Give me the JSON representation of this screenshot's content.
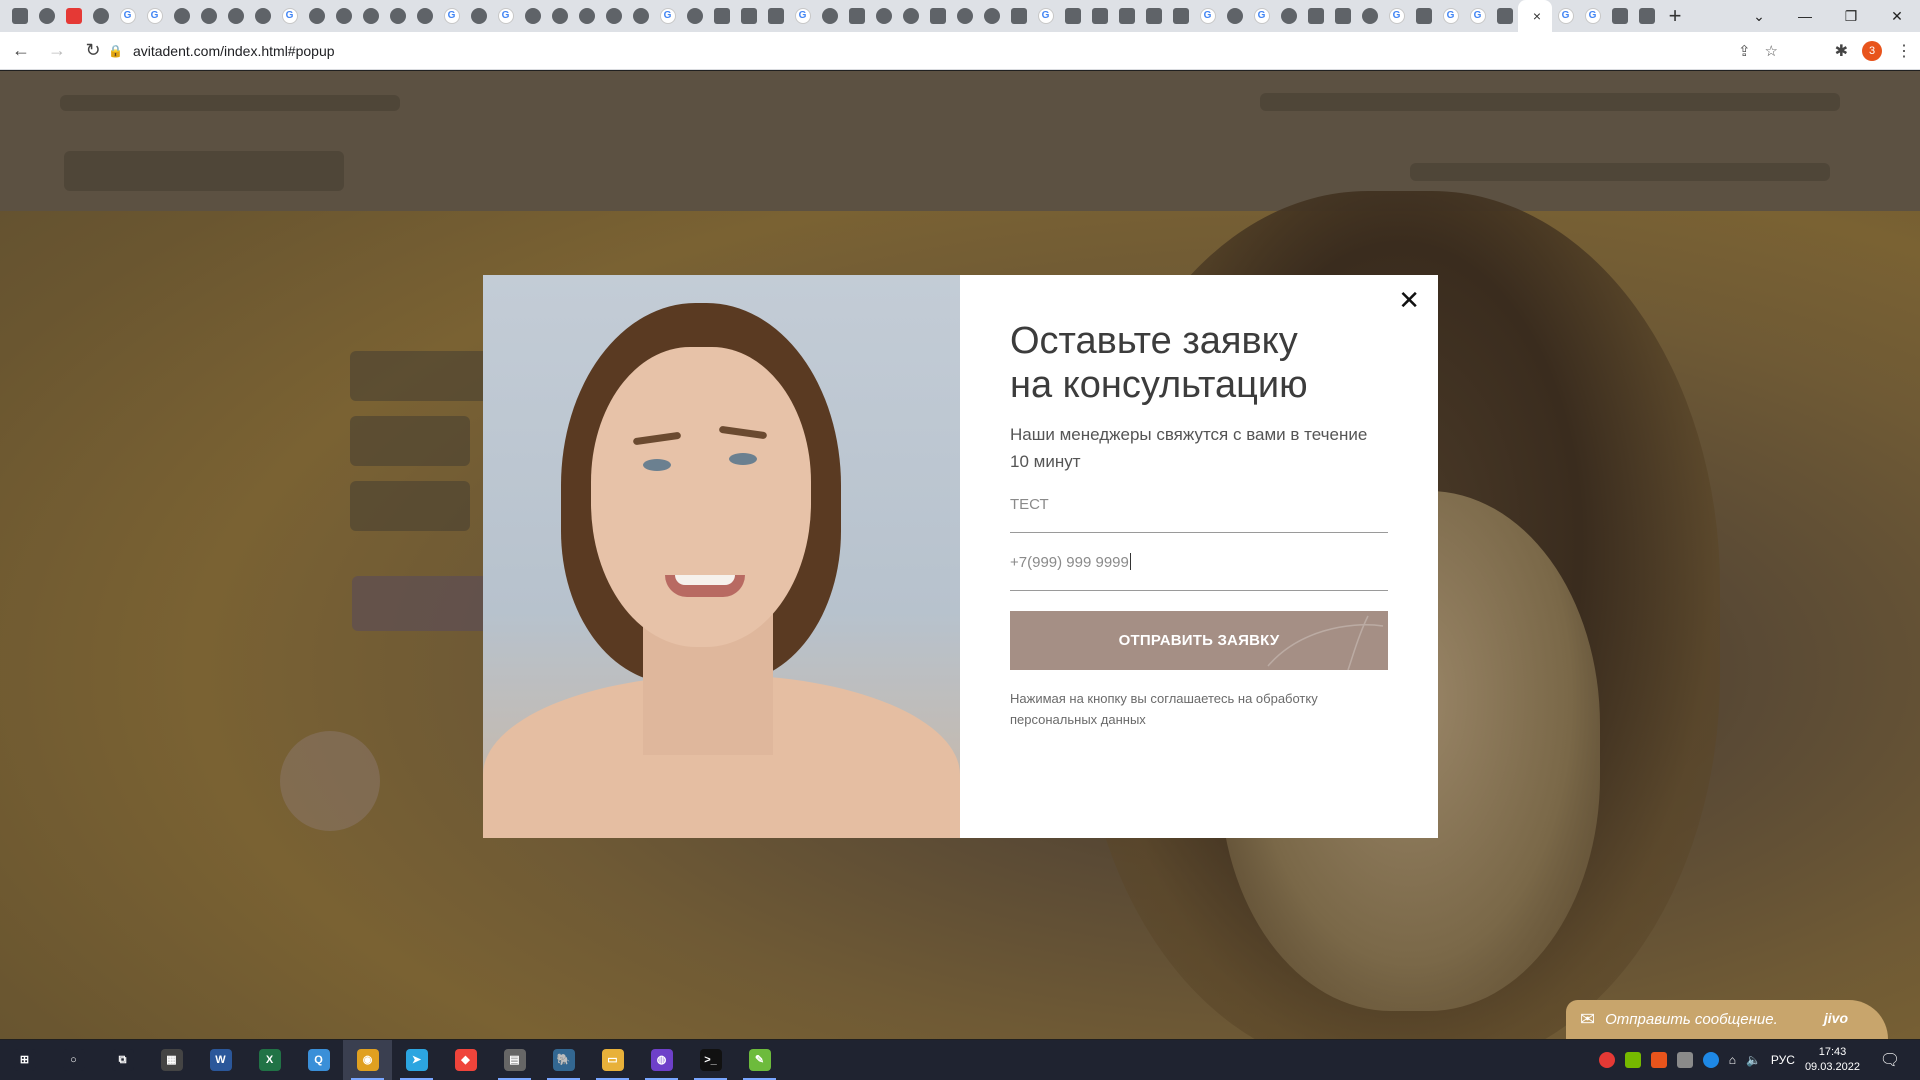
{
  "browser": {
    "tab_count_before_active": 56,
    "active_tab_close": "×",
    "new_tab": "+",
    "window_controls": {
      "dropdown": "⌄",
      "minimize": "—",
      "restore": "❐",
      "close": "✕"
    },
    "url": "avitadent.com/index.html#popup",
    "profile_badge": "3"
  },
  "modal": {
    "close_label": "✕",
    "title_line1": "Оставьте заявку",
    "title_line2": "на консультацию",
    "subtitle": "Наши менеджеры свяжутся с вами в течение 10 минут",
    "name_field_value": "ТЕСТ",
    "phone_field_value": "+7(999) 999 9999",
    "submit_label": "ОТПРАВИТЬ ЗАЯВКУ",
    "consent": "Нажимая на кнопку вы соглашаетесь на обработку персональных данных"
  },
  "jivo": {
    "text": "Отправить сообщение.",
    "logo": "jivo"
  },
  "taskbar": {
    "apps": [
      {
        "name": "start-icon",
        "glyph": "⊞",
        "color": "#1f2330"
      },
      {
        "name": "search-icon",
        "glyph": "○",
        "color": "#1f2330"
      },
      {
        "name": "task-view-icon",
        "glyph": "⧉",
        "color": "#1f2330"
      },
      {
        "name": "calculator-icon",
        "glyph": "▦",
        "color": "#444"
      },
      {
        "name": "word-icon",
        "glyph": "W",
        "color": "#2b579a"
      },
      {
        "name": "excel-icon",
        "glyph": "X",
        "color": "#217346"
      },
      {
        "name": "qbittorrent-icon",
        "glyph": "Q",
        "color": "#3a8fd8"
      },
      {
        "name": "chrome-icon",
        "glyph": "◉",
        "color": "#e0a020"
      },
      {
        "name": "telegram-icon",
        "glyph": "➤",
        "color": "#2ca5e0"
      },
      {
        "name": "anydesk-icon",
        "glyph": "◆",
        "color": "#ef443b"
      },
      {
        "name": "file-manager-icon",
        "glyph": "▤",
        "color": "#666"
      },
      {
        "name": "postgres-icon",
        "glyph": "🐘",
        "color": "#336791"
      },
      {
        "name": "explorer-icon",
        "glyph": "▭",
        "color": "#e8b13a"
      },
      {
        "name": "github-icon",
        "glyph": "◍",
        "color": "#6e40c9"
      },
      {
        "name": "terminal-icon",
        "glyph": ">_",
        "color": "#111"
      },
      {
        "name": "notepad-icon",
        "glyph": "✎",
        "color": "#6dbb3c"
      }
    ],
    "active_app_index": 7,
    "lang": "РУС",
    "time": "17:43",
    "date": "09.03.2022"
  }
}
